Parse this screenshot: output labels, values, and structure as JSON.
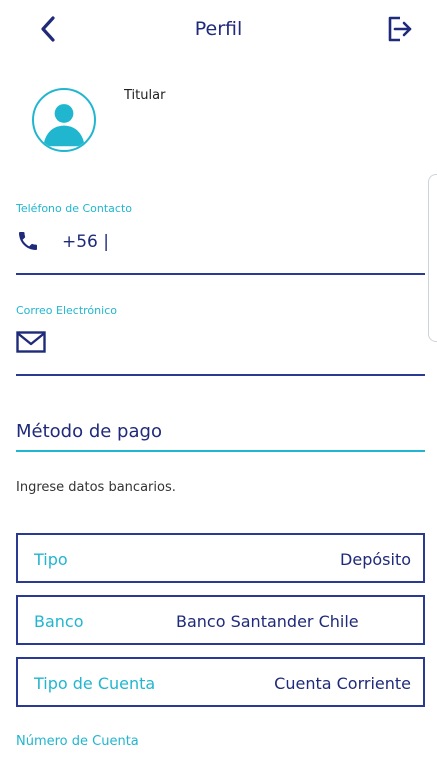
{
  "header": {
    "title": "Perfil",
    "back_icon": "chevron-left-icon",
    "logout_icon": "logout-icon"
  },
  "profile": {
    "holder_label": "Titular",
    "avatar_icon": "user-avatar-icon"
  },
  "contact": {
    "phone_label": "Teléfono de Contacto",
    "phone_value": "+56 |",
    "phone_icon": "phone-icon",
    "email_label": "Correo Electrónico",
    "email_value": "",
    "email_icon": "mail-icon"
  },
  "payment": {
    "section_title": "Método de pago",
    "hint": "Ingrese datos bancarios.",
    "fields": [
      {
        "label": "Tipo",
        "value": "Depósito"
      },
      {
        "label": "Banco",
        "value": "Banco Santander Chile"
      },
      {
        "label": "Tipo de Cuenta",
        "value": "Cuenta Corriente"
      }
    ],
    "account_number_label": "Número de Cuenta"
  },
  "colors": {
    "primary": "#1f2a7a",
    "accent": "#21b6cf",
    "line": "#2a3a92"
  }
}
